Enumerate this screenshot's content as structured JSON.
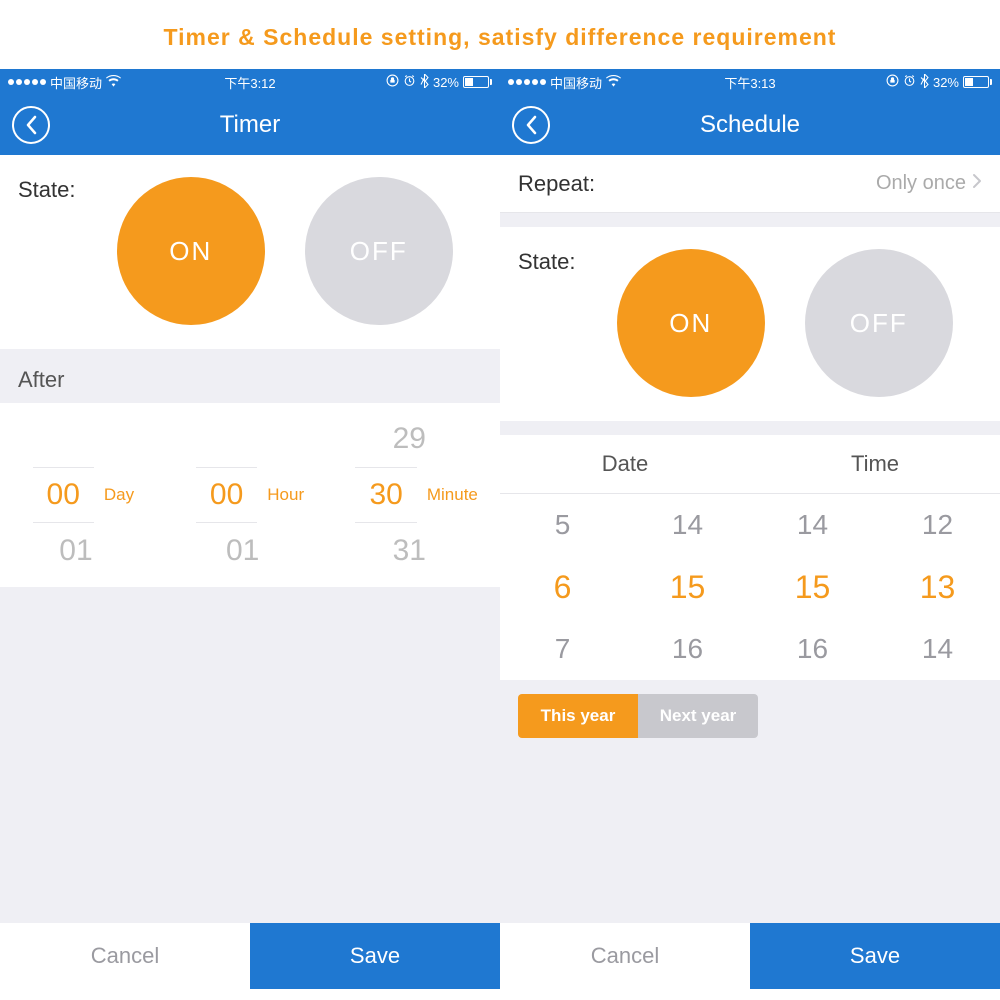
{
  "banner": "Timer & Schedule setting, satisfy difference requirement",
  "timer": {
    "status": {
      "carrier": "中国移动",
      "time": "下午3:12",
      "battery_pct": "32%"
    },
    "nav_title": "Timer",
    "state_label": "State:",
    "on_label": "ON",
    "off_label": "OFF",
    "after_label": "After",
    "picker": {
      "day": {
        "prev": "",
        "sel": "00",
        "next": "01",
        "unit": "Day"
      },
      "hour": {
        "prev": "",
        "sel": "00",
        "next": "01",
        "unit": "Hour"
      },
      "minute": {
        "prev": "29",
        "sel": "30",
        "next": "31",
        "unit": "Minute"
      }
    },
    "cancel": "Cancel",
    "save": "Save"
  },
  "schedule": {
    "status": {
      "carrier": "中国移动",
      "time": "下午3:13",
      "battery_pct": "32%"
    },
    "nav_title": "Schedule",
    "repeat_label": "Repeat:",
    "repeat_value": "Only once",
    "state_label": "State:",
    "on_label": "ON",
    "off_label": "OFF",
    "dt_header": {
      "date": "Date",
      "time": "Time"
    },
    "picker": {
      "month": {
        "prev": "5",
        "sel": "6",
        "next": "7"
      },
      "day": {
        "prev": "14",
        "sel": "15",
        "next": "16"
      },
      "hour": {
        "prev": "14",
        "sel": "15",
        "next": "16"
      },
      "minute": {
        "prev": "12",
        "sel": "13",
        "next": "14"
      }
    },
    "year_seg": {
      "this": "This year",
      "next": "Next year"
    },
    "cancel": "Cancel",
    "save": "Save"
  }
}
